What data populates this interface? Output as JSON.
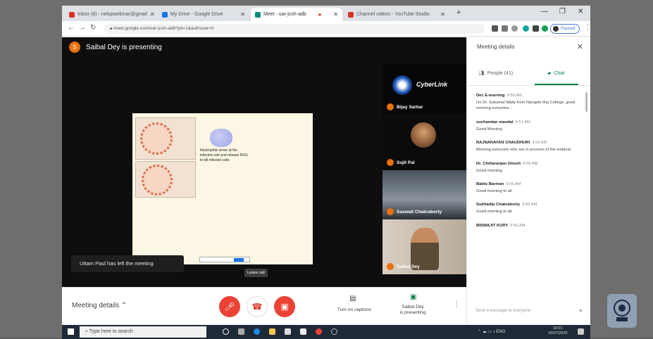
{
  "browser": {
    "tabs": [
      {
        "title": "Inbox (8) - nelspwebinar@gmail",
        "favicon_color": "#d93025"
      },
      {
        "title": "My Drive - Google Drive",
        "favicon_color": "#1a73e8"
      },
      {
        "title": "Meet - uar-jcxh-adb",
        "favicon_color": "#00897b"
      },
      {
        "title": "Channel videos - YouTube Studio",
        "favicon_color": "#d93025"
      }
    ],
    "url": "meet.google.com/uar-jcxh-adb?pli=1&authuser=0",
    "paused_label": "Paused",
    "profile_initial": "S"
  },
  "meet": {
    "presenter_initial": "S",
    "presenter_text": "Saibal Dey is presenting",
    "slide": {
      "caption": "Neutrophils arrive at the infection site and release ROS to kill infected cells"
    },
    "toast": "Uttam Paul has left the meeting",
    "leave_chip": "Leave call",
    "participants": [
      {
        "name": "Bijay Sarkar",
        "logo_text": "CyberLink"
      },
      {
        "name": "Sujit Pal"
      },
      {
        "name": "Saswati Chakraborty"
      },
      {
        "name": "Saibal Dey"
      }
    ]
  },
  "controls": {
    "meeting_details": "Meeting details",
    "captions_label": "Turn on captions",
    "presenting_label_1": "Saibal Dey",
    "presenting_label_2": "is presenting"
  },
  "panel": {
    "title": "Meeting details",
    "people_tab": "People (41)",
    "chat_tab": "Chat",
    "messages": [
      {
        "sender": "Dec E-learning",
        "time": "9:50 AM",
        "text": "I'm Dr. Sukamal Maity from Narajole Raj College, good morning everyone..."
      },
      {
        "sender": "suchandan mandal",
        "time": "9:51 AM",
        "text": "Good Morning"
      },
      {
        "sender": "RAJNARAYAN CHAUDHURI",
        "time": "9:53 AM",
        "text": "Morning everyone who are in process of the webinar"
      },
      {
        "sender": "Dr. Chittaranjan Ghosh",
        "time": "9:55 AM",
        "text": "Good morning"
      },
      {
        "sender": "Bablu Barman",
        "time": "9:56 AM",
        "text": "Good morning to all"
      },
      {
        "sender": "Subhadip Chakraborty",
        "time": "9:56 AM",
        "text": "Good morning to all"
      },
      {
        "sender": "BISWAJIT KURY",
        "time": "9:56 AM",
        "text": ""
      }
    ],
    "input_placeholder": "Send a message to everyone"
  },
  "taskbar": {
    "search_placeholder": "Type here to search",
    "clock_time": "10:01",
    "clock_date": "16/07/2020",
    "lang": "ENG"
  }
}
